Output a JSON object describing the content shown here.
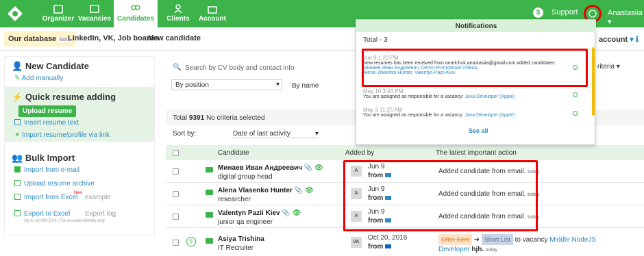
{
  "nav": {
    "items": [
      {
        "label": "Organizer"
      },
      {
        "label": "Vacancies"
      },
      {
        "label": "Candidates"
      },
      {
        "label": "Clients"
      },
      {
        "label": "Account"
      }
    ],
    "support": "Support",
    "support_icon": "$",
    "user": "Anastasiia"
  },
  "subnav": {
    "our_database": "Our database",
    "db_count": "9391",
    "linkedin": "LinkedIn, VK, Job boards",
    "new_candidate": "New candidate",
    "account": "account"
  },
  "sidebar": {
    "new_candidate_title": "New Candidate",
    "add_manually": "Add manually",
    "quick_title": "Quick resume adding",
    "upload_resume": "Upload resume",
    "insert_text": "Insert resume text",
    "import_link": "Import resume/profile via link",
    "bulk_title": "Bulk Import",
    "import_email": "Import from e-mail",
    "upload_archive": "Upload resume archive",
    "import_excel": "Import from Excel",
    "new_badge": "New",
    "example": "example",
    "export_excel": "Export to Excel",
    "export_log": "Export log",
    "export_note": "Up to 10.000 CVs | For account Admins only"
  },
  "search": {
    "placeholder": "Search by CV body and contact info",
    "position": "By position",
    "byname": "By name",
    "criteria": "riteria"
  },
  "list": {
    "total_label": "Total",
    "total": "9391",
    "no_criteria": "No criteria selected",
    "sort_by": "Sort by:",
    "sort_value": "Date of last activity",
    "col_candidate": "Candidate",
    "col_added": "Added by",
    "col_action": "The latest important action",
    "rows": [
      {
        "name": "Минаев Иван Андреевич",
        "role": "digital group head",
        "avatar": "A",
        "date": "Jun 9",
        "from": "from",
        "action": "Added candidate from email.",
        "when": "today"
      },
      {
        "name": "Alena Vlasenko Hunter",
        "role": "researcher",
        "avatar": "A",
        "date": "Jun 9",
        "from": "from",
        "action": "Added candidate from email.",
        "when": "today"
      },
      {
        "name": "Valentyn Pazii Kiev",
        "role": "junior qa engineer",
        "avatar": "A",
        "date": "Jun 9",
        "from": "from",
        "action": "Added candidate from email.",
        "when": "today"
      },
      {
        "name": "Asiya Trishina",
        "role": "IT Recruiter",
        "avatar": "VK",
        "date": "Oct 20, 2016",
        "from": "from",
        "offer": "Offer Sent",
        "shortlist": "Short List",
        "to_vacancy": "to vacancy",
        "vacancy": "Middle NodeJS",
        "vacancy2": "Developer",
        "by": "hjh.",
        "when": "today",
        "num": "5"
      }
    ]
  },
  "notifications": {
    "title": "Notifications",
    "total": "Total - 3",
    "items": [
      {
        "time": "Jun 9 1:20 PM",
        "text": "New resumes has been received from omelchuk.anastasiia@gmail.com added candidates:",
        "links": "Минаев Иван Андреевич, Demo Promotional Videos,",
        "links2": "Alena Vlasenko Hunter, Valentyn Pazii Kiev"
      },
      {
        "time": "May 10 3:43 PM",
        "text": "You are assigned as responsible for a vacancy:",
        "link": "Java Developer (Apple)"
      },
      {
        "time": "May 3 11:25 AM",
        "text": "You are assigned as responsible for a vacancy:",
        "link": "Java Developer (Apple)"
      }
    ],
    "see_all": "See all"
  },
  "colors": {
    "brand": "#3cb44a",
    "highlight": "#e00000",
    "link": "#2f8ac4"
  }
}
